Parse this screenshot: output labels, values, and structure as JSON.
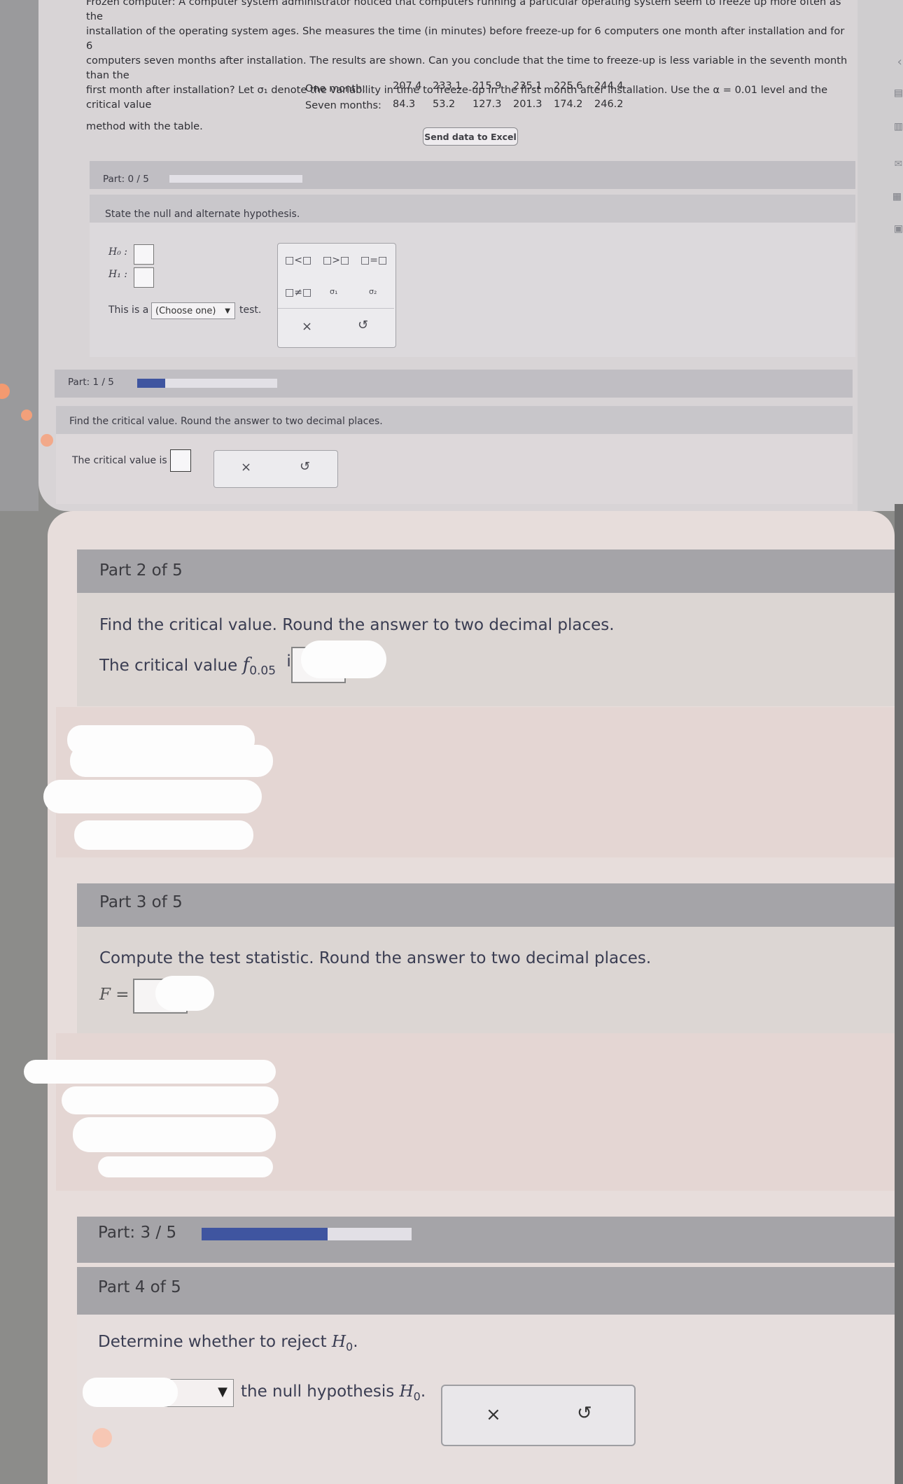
{
  "problem": {
    "line1": "Frozen computer: A computer system administrator noticed that computers running a particular operating system seem to freeze up more often as the",
    "line2": "installation of the operating system ages. She measures the time (in minutes) before freeze-up for 6 computers one month after installation and for 6",
    "line3": "computers seven months after installation. The results are shown. Can you conclude that the time to freeze-up is less variable in the seventh month than the",
    "line4": "first month after installation? Let σ₁ denote the variability in time to freeze-up in the first month after installation. Use the α = 0.01 level and the critical value",
    "line5": "method with the table."
  },
  "data_table": {
    "rows": [
      {
        "label": "One month:",
        "values": [
          "207.4",
          "233.1",
          "215.9",
          "235.1",
          "225.6",
          "244.4"
        ]
      },
      {
        "label": "Seven months:",
        "values": [
          "84.3",
          "53.2",
          "127.3",
          "201.3",
          "174.2",
          "246.2"
        ]
      }
    ],
    "send_button": "Send data to Excel"
  },
  "upper": {
    "part0": {
      "label": "Part: 0 / 5",
      "progress": 0.0
    },
    "hypothesis_prompt": "State the null and alternate hypothesis.",
    "h0_label": "H₀ :",
    "h1_label": "H₁ :",
    "test_prefix": "This is a",
    "test_select": "(Choose one)",
    "test_suffix": "test.",
    "palette": {
      "lt": "□<□",
      "gt": "□>□",
      "eq": "□=□",
      "ne": "□≠□",
      "sigma1": "σ₁",
      "sigma2": "σ₂",
      "clear": "×",
      "undo": "↺"
    },
    "part1": {
      "label": "Part: 1 / 5",
      "progress": 0.2
    },
    "critical_prompt": "Find the critical value. Round the answer to two decimal places.",
    "critical_label": "The critical value is",
    "clear": "×",
    "undo": "↺"
  },
  "lower": {
    "part2": {
      "title": "Part 2 of 5",
      "prompt": "Find the critical value. Round the answer to two decimal places.",
      "critical_label": "The critical value",
      "critical_symbol": "f",
      "critical_sub": "0.05",
      "critical_is": "is"
    },
    "part3": {
      "title": "Part 3 of 5",
      "prompt": "Compute the test statistic. Round the answer to two decimal places.",
      "stat_label": "F ="
    },
    "progress": {
      "label": "Part: 3 / 5",
      "progress": 0.6
    },
    "part4": {
      "title": "Part 4 of 5",
      "prompt": "Determine whether to reject",
      "prompt_symbol": "H",
      "prompt_sub": "0",
      "prompt_end": ".",
      "select_arrow": "▼",
      "suffix": "the null hypothesis",
      "suffix_symbol": "H",
      "suffix_sub": "0",
      "suffix_end": ".",
      "clear": "×",
      "undo": "↺"
    }
  },
  "side_icons": [
    "chevron-left-icon",
    "list-icon",
    "book-icon",
    "mail-icon",
    "chart-icon",
    "calculator-icon"
  ],
  "colors": {
    "progress_fill": "#3f55a0",
    "accent_orange": "#f39a70"
  }
}
